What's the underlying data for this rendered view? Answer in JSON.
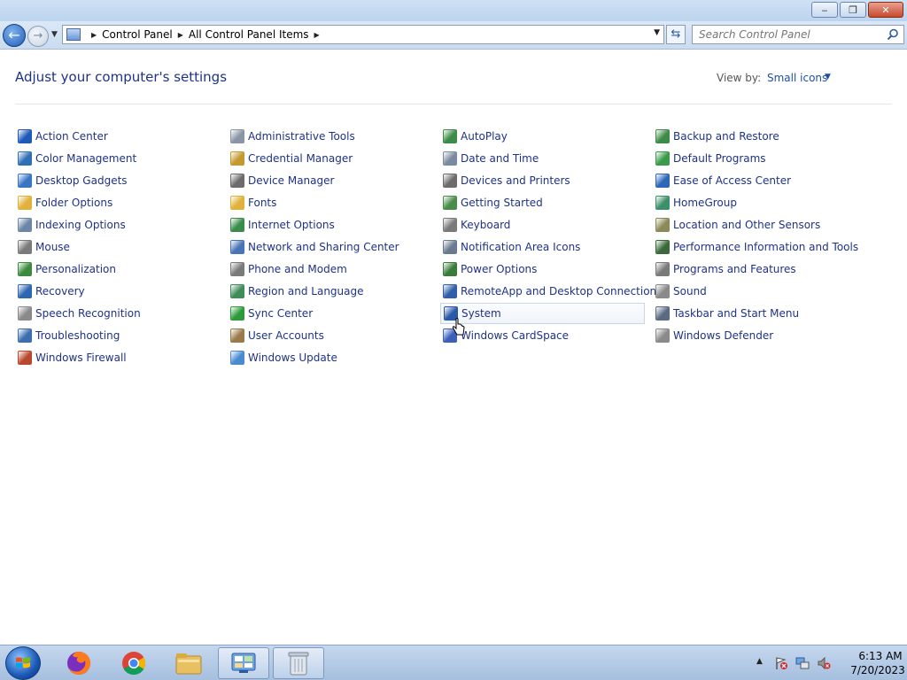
{
  "window": {
    "buttons": {
      "minimize": "‒",
      "maximize": "❐",
      "close": "✕"
    }
  },
  "nav": {
    "back_glyph": "←",
    "forward_glyph": "→",
    "breadcrumbs": [
      "Control Panel",
      "All Control Panel Items"
    ],
    "search_placeholder": "Search Control Panel"
  },
  "header": {
    "title": "Adjust your computer's settings",
    "view_by_label": "View by:",
    "view_by_value": "Small icons"
  },
  "items": [
    [
      {
        "label": "Action Center",
        "icon": "flag-icon",
        "color": "#1f5ab8"
      },
      {
        "label": "Color Management",
        "icon": "monitor-color-icon",
        "color": "#2f6fb6"
      },
      {
        "label": "Desktop Gadgets",
        "icon": "gadgets-icon",
        "color": "#3a75c4"
      },
      {
        "label": "Folder Options",
        "icon": "folder-icon",
        "color": "#e2b13c"
      },
      {
        "label": "Indexing Options",
        "icon": "indexing-icon",
        "color": "#6b86a8"
      },
      {
        "label": "Mouse",
        "icon": "mouse-icon",
        "color": "#7a7a7a"
      },
      {
        "label": "Personalization",
        "icon": "personalization-icon",
        "color": "#3d8a3f"
      },
      {
        "label": "Recovery",
        "icon": "recovery-icon",
        "color": "#2e66b4"
      },
      {
        "label": "Speech Recognition",
        "icon": "microphone-icon",
        "color": "#8a8a8a"
      },
      {
        "label": "Troubleshooting",
        "icon": "troubleshooting-icon",
        "color": "#3c6fae"
      },
      {
        "label": "Windows Firewall",
        "icon": "firewall-icon",
        "color": "#b8492f"
      }
    ],
    [
      {
        "label": "Administrative Tools",
        "icon": "admin-tools-icon",
        "color": "#8a95a6"
      },
      {
        "label": "Credential Manager",
        "icon": "credential-icon",
        "color": "#c4992e"
      },
      {
        "label": "Device Manager",
        "icon": "device-manager-icon",
        "color": "#6c6c6c"
      },
      {
        "label": "Fonts",
        "icon": "fonts-icon",
        "color": "#e0b23c"
      },
      {
        "label": "Internet Options",
        "icon": "internet-icon",
        "color": "#3b8b4a"
      },
      {
        "label": "Network and Sharing Center",
        "icon": "network-icon",
        "color": "#4a74b8"
      },
      {
        "label": "Phone and Modem",
        "icon": "phone-icon",
        "color": "#7a7a7a"
      },
      {
        "label": "Region and Language",
        "icon": "globe-icon",
        "color": "#3e8c5a"
      },
      {
        "label": "Sync Center",
        "icon": "sync-icon",
        "color": "#2f9a3c"
      },
      {
        "label": "User Accounts",
        "icon": "users-icon",
        "color": "#9a7a4a"
      },
      {
        "label": "Windows Update",
        "icon": "update-icon",
        "color": "#4a8ad0"
      }
    ],
    [
      {
        "label": "AutoPlay",
        "icon": "autoplay-icon",
        "color": "#3e8a48"
      },
      {
        "label": "Date and Time",
        "icon": "clock-icon",
        "color": "#7a8aa0"
      },
      {
        "label": "Devices and Printers",
        "icon": "printer-icon",
        "color": "#6c6c6c"
      },
      {
        "label": "Getting Started",
        "icon": "getting-started-icon",
        "color": "#4a8c4a"
      },
      {
        "label": "Keyboard",
        "icon": "keyboard-icon",
        "color": "#7a7a7a"
      },
      {
        "label": "Notification Area Icons",
        "icon": "notification-icon",
        "color": "#6a7a90"
      },
      {
        "label": "Power Options",
        "icon": "power-icon",
        "color": "#3a7a3a"
      },
      {
        "label": "RemoteApp and Desktop Connections",
        "icon": "remoteapp-icon",
        "color": "#2f5fa8"
      },
      {
        "label": "System",
        "icon": "system-icon",
        "color": "#2a58a8",
        "hover": true
      },
      {
        "label": "Windows CardSpace",
        "icon": "cardspace-icon",
        "color": "#3a60b8"
      }
    ],
    [
      {
        "label": "Backup and Restore",
        "icon": "backup-icon",
        "color": "#3e8a48"
      },
      {
        "label": "Default Programs",
        "icon": "default-programs-icon",
        "color": "#3a9a4a"
      },
      {
        "label": "Ease of Access Center",
        "icon": "ease-of-access-icon",
        "color": "#2f66b6"
      },
      {
        "label": "HomeGroup",
        "icon": "homegroup-icon",
        "color": "#3b8f6a"
      },
      {
        "label": "Location and Other Sensors",
        "icon": "sensors-icon",
        "color": "#8a8a5a"
      },
      {
        "label": "Performance Information and Tools",
        "icon": "performance-icon",
        "color": "#3a6a3a"
      },
      {
        "label": "Programs and Features",
        "icon": "programs-icon",
        "color": "#7a7a7a"
      },
      {
        "label": "Sound",
        "icon": "speaker-icon",
        "color": "#8a8a8a"
      },
      {
        "label": "Taskbar and Start Menu",
        "icon": "taskbar-icon",
        "color": "#5a6a80"
      },
      {
        "label": "Windows Defender",
        "icon": "defender-icon",
        "color": "#8a8a8a"
      }
    ]
  ],
  "taskbar": {
    "apps": [
      {
        "name": "firefox",
        "icon": "firefox-icon"
      },
      {
        "name": "chrome",
        "icon": "chrome-icon"
      },
      {
        "name": "explorer",
        "icon": "folder-icon"
      },
      {
        "name": "control-panel",
        "icon": "control-panel-icon",
        "active": true
      },
      {
        "name": "recycle",
        "icon": "recycle-icon",
        "active": true
      }
    ],
    "clock_time": "6:13 AM",
    "clock_date": "7/20/2023"
  }
}
